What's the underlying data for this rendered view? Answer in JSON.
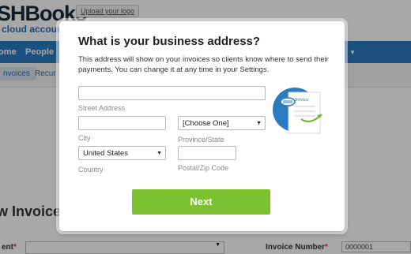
{
  "brand": {
    "logo_text": "SHBooks",
    "logo_sub": "cloud accounting",
    "upload_logo": "Upload your logo"
  },
  "nav": {
    "items": [
      "ome",
      "People"
    ]
  },
  "subnav": {
    "tabs": [
      "nvoices",
      "Recur"
    ]
  },
  "page": {
    "title": "w Invoice",
    "client_label": "ent",
    "invoice_number_label": "Invoice Number",
    "invoice_number_value": "0000001"
  },
  "modal": {
    "title": "What is your business address?",
    "description": "This address will show on your invoices so clients know where to send their payments. You can change it at any time in your Settings.",
    "fields": {
      "street_label": "Street Address",
      "street_value": "",
      "city_label": "City",
      "city_value": "",
      "province_label": "Province/State",
      "province_selected": "[Choose One]",
      "country_label": "Country",
      "country_selected": "United States",
      "postal_label": "Postal/Zip Code",
      "postal_value": ""
    },
    "next_label": "Next",
    "illustration_text": "Invoice"
  },
  "colors": {
    "nav_blue": "#2b7bc1",
    "next_green": "#7cc230",
    "required_red": "#d33333"
  }
}
